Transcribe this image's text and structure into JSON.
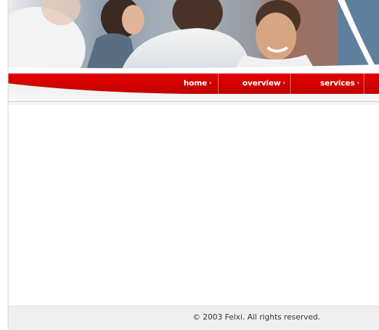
{
  "header": {
    "hero_image": "team-meeting-photo",
    "colors": {
      "brand_red": "#d40000",
      "brand_red_dark": "#b00000"
    }
  },
  "nav": {
    "items": [
      {
        "label": "home",
        "icon": "chevron-right-icon",
        "glyph": "›"
      },
      {
        "label": "overview",
        "icon": "chevron-right-icon",
        "glyph": "›"
      },
      {
        "label": "services",
        "icon": "chevron-right-icon",
        "glyph": "›"
      }
    ]
  },
  "footer": {
    "copyright": "© 2003 Felxi. All rights reserved."
  }
}
